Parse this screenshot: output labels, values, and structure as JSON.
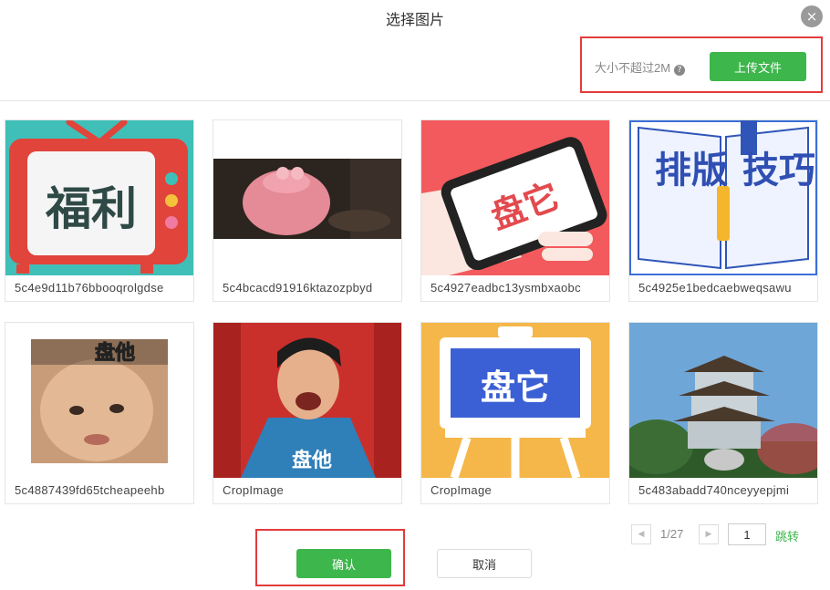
{
  "dialog": {
    "title": "选择图片",
    "close_icon": "×"
  },
  "upload": {
    "size_hint": "大小不超过2M",
    "help_icon": "?",
    "button_label": "上传文件"
  },
  "images": [
    {
      "name": "5c4e9d11b76bbooqrolgdse",
      "thumb_text": "福利",
      "thumb_icon": "tv-welfare-icon"
    },
    {
      "name": "5c4bcacd91916ktazozpbyd",
      "thumb_icon": "pink-pig-photo"
    },
    {
      "name": "5c4927eadbc13ysmbxaobc",
      "thumb_text": "盘它",
      "thumb_icon": "phone-hand-icon"
    },
    {
      "name": "5c4925e1bedcaebweqsawu",
      "thumb_text_1": "排版",
      "thumb_text_2": "技巧",
      "thumb_icon": "open-book-icon"
    },
    {
      "name": "5c4887439fd65tcheapeehb",
      "thumb_text": "盘他",
      "thumb_icon": "baby-face-photo"
    },
    {
      "name": "CropImage",
      "thumb_text": "盘他",
      "thumb_icon": "laughing-man-photo"
    },
    {
      "name": "CropImage",
      "thumb_text": "盘它",
      "thumb_icon": "easel-board-icon"
    },
    {
      "name": "5c483abadd740nceyyepjmi",
      "thumb_icon": "pagoda-photo"
    }
  ],
  "pagination": {
    "prev_icon": "◀",
    "info": "1/27",
    "next_icon": "▶",
    "page_value": "1",
    "jump_label": "跳转"
  },
  "actions": {
    "confirm_label": "确认",
    "cancel_label": "取消"
  },
  "colors": {
    "accent_green": "#3db64b",
    "highlight_red": "#e23b3b"
  }
}
